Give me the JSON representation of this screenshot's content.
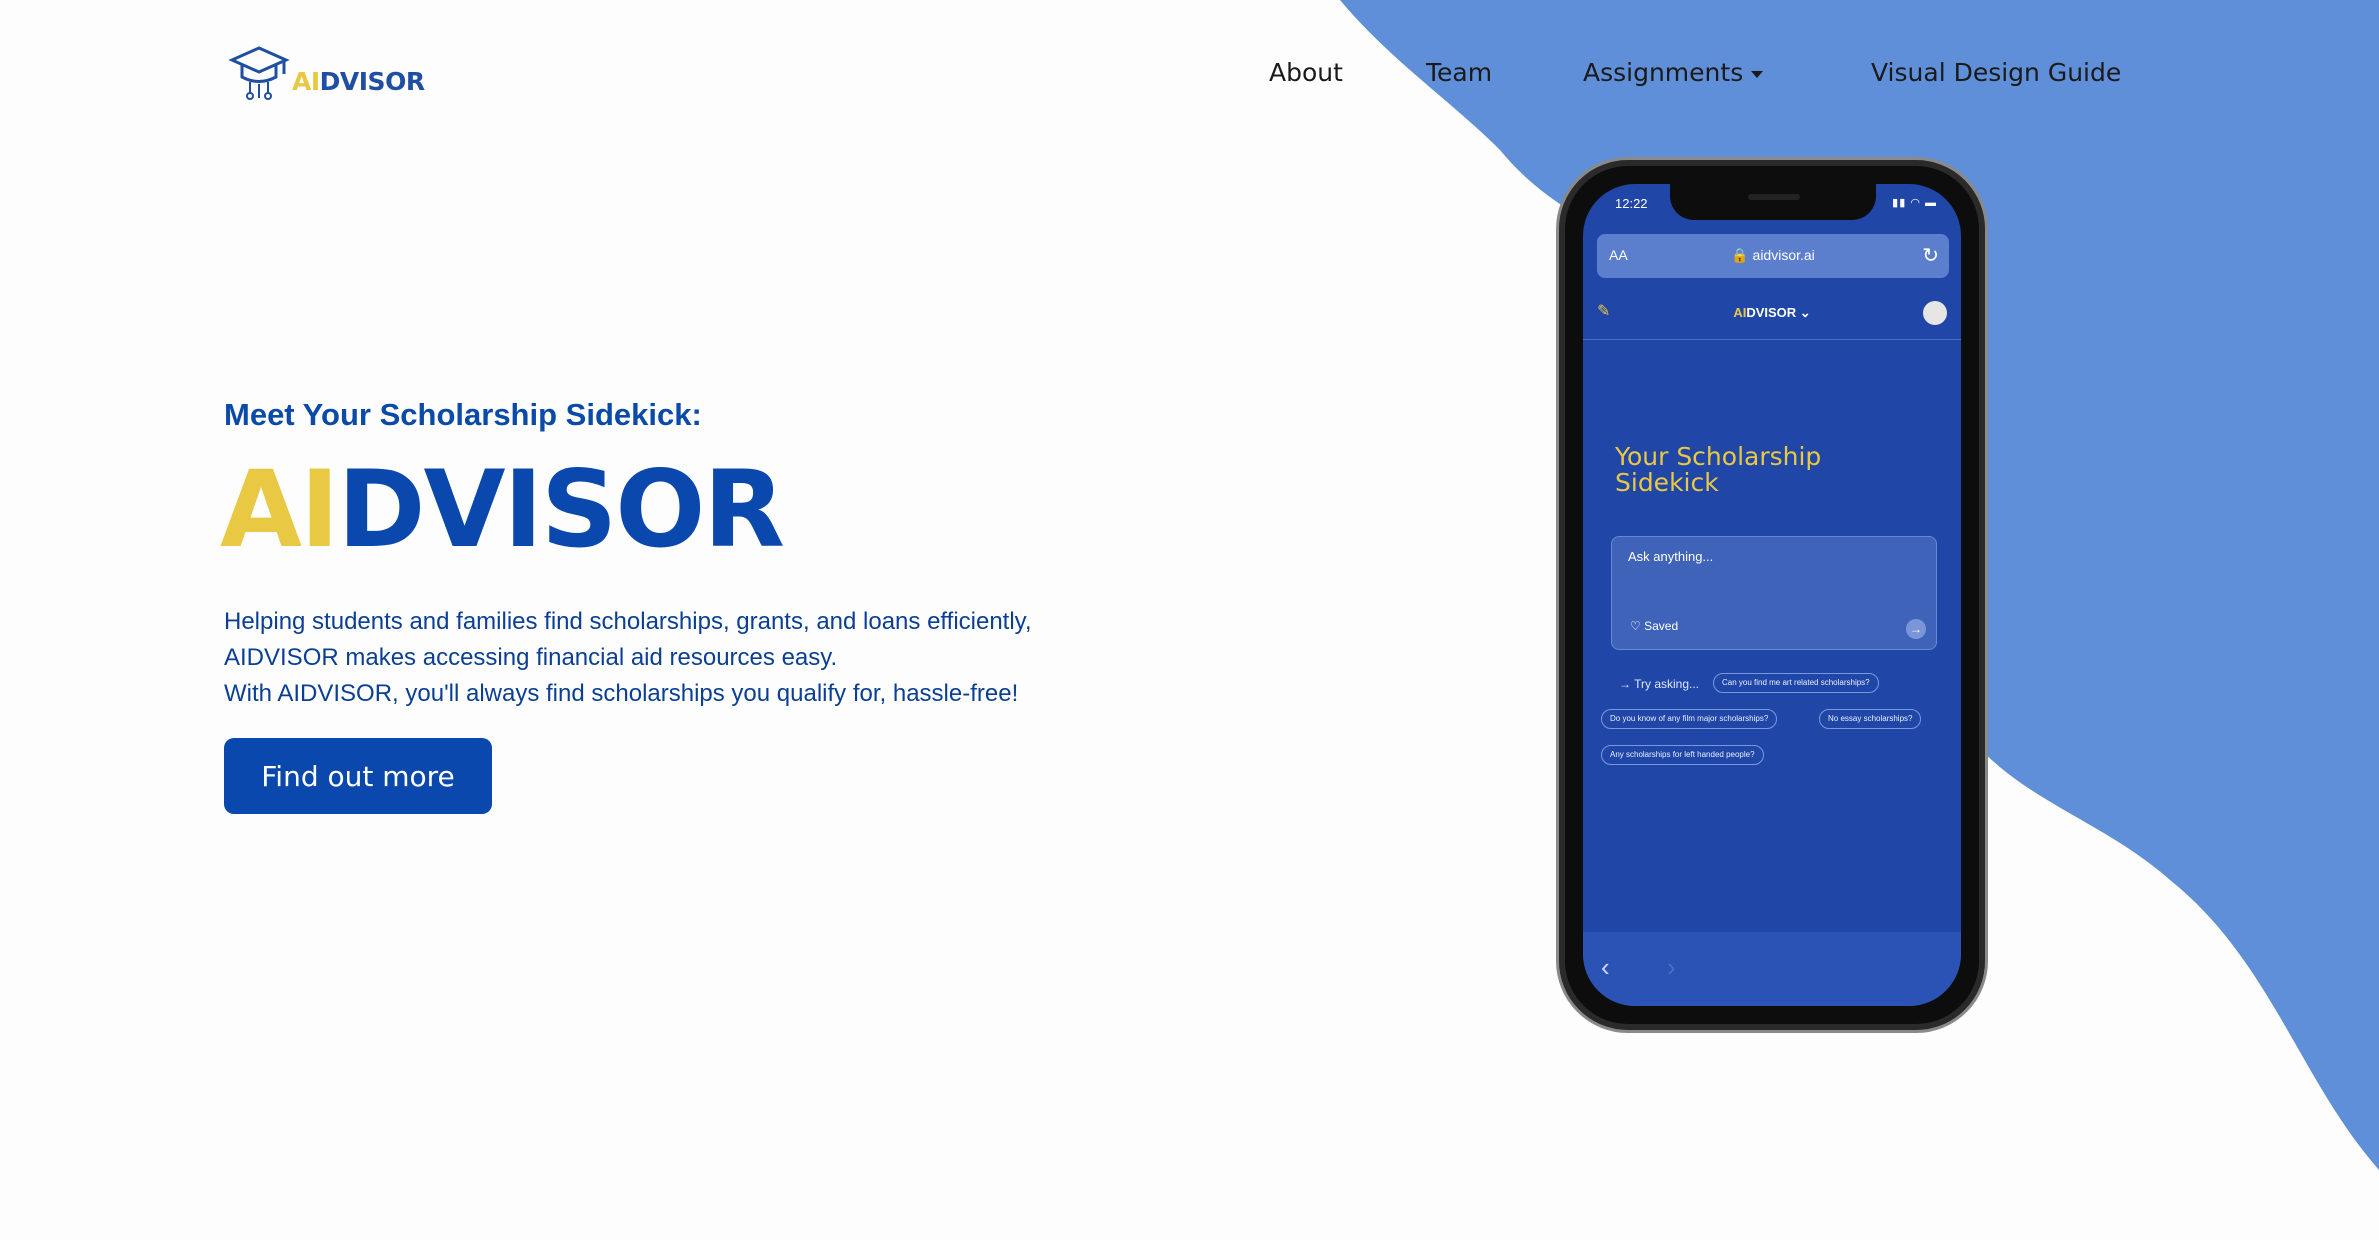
{
  "brand": {
    "logo_ai": "AI",
    "logo_rest": "DVISOR",
    "colors": {
      "primary": "#0a48ad",
      "accent": "#e9c843",
      "blob": "#5e8fd8"
    }
  },
  "nav": {
    "items": [
      {
        "label": "About"
      },
      {
        "label": "Team"
      },
      {
        "label": "Assignments"
      },
      {
        "label": "Visual Design Guide"
      }
    ]
  },
  "hero": {
    "kicker": "Meet Your Scholarship Sidekick:",
    "title_ai": "AI",
    "title_rest": "DVISOR",
    "lines": [
      "Helping students and families find scholarships, grants, and loans efficiently,",
      "AIDVISOR makes accessing financial aid resources easy.",
      "With AIDVISOR, you'll always find scholarships you qualify for, hassle-free!"
    ],
    "cta": "Find out more"
  },
  "phone": {
    "time": "12:22",
    "url_aa": "AA",
    "url": "aidvisor.ai",
    "app_logo_ai": "AI",
    "app_logo_rest": "DVISOR",
    "title_lines": [
      "Your Scholarship",
      "Sidekick"
    ],
    "ask_placeholder": "Ask anything...",
    "saved": "Saved",
    "try_asking": "Try asking...",
    "suggestions": [
      "Can you find me art related scholarships?",
      "Do you know of any film major scholarships?",
      "No essay scholarships?",
      "Any scholarships for left handed people?"
    ]
  }
}
